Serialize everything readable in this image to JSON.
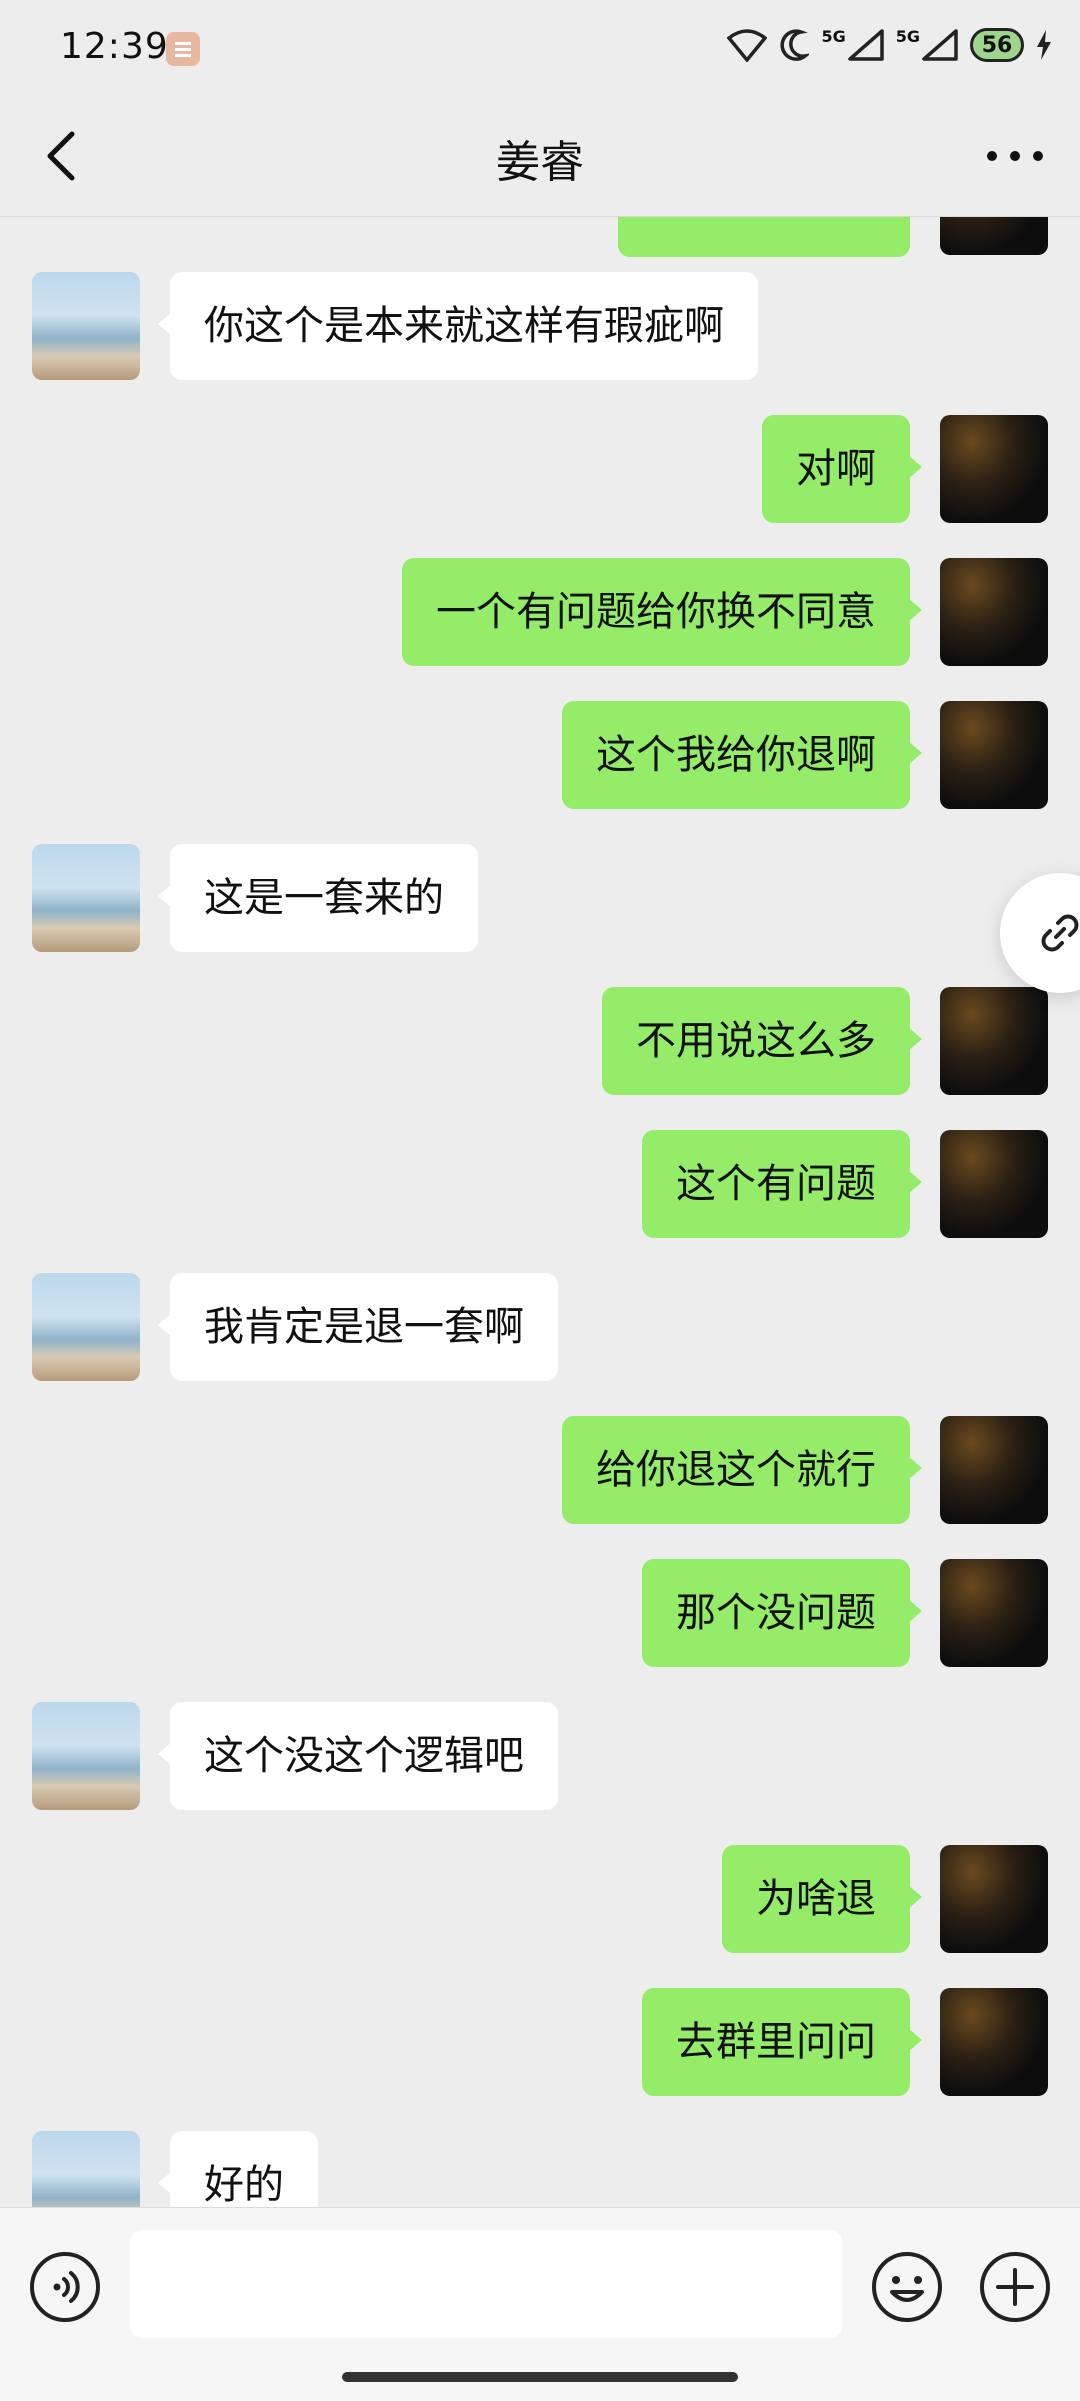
{
  "status": {
    "time": "12:39",
    "battery": "56",
    "network_1": "5G",
    "network_2": "5G"
  },
  "header": {
    "title": "姜睿"
  },
  "messages": [
    {
      "side": "left",
      "text": "你这个是本来就这样有瑕疵啊"
    },
    {
      "side": "right",
      "text": "对啊"
    },
    {
      "side": "right",
      "text": "一个有问题给你换不同意"
    },
    {
      "side": "right",
      "text": "这个我给你退啊"
    },
    {
      "side": "left",
      "text": "这是一套来的"
    },
    {
      "side": "right",
      "text": "不用说这么多"
    },
    {
      "side": "right",
      "text": "这个有问题"
    },
    {
      "side": "left",
      "text": "我肯定是退一套啊"
    },
    {
      "side": "right",
      "text": "给你退这个就行"
    },
    {
      "side": "right",
      "text": "那个没问题"
    },
    {
      "side": "left",
      "text": "这个没这个逻辑吧"
    },
    {
      "side": "right",
      "text": "为啥退"
    },
    {
      "side": "right",
      "text": "去群里问问"
    },
    {
      "side": "left",
      "text": "好的"
    }
  ],
  "input": {
    "value": ""
  },
  "colors": {
    "sent_bubble": "#95ec69",
    "received_bubble": "#ffffff",
    "background": "#ededed"
  }
}
